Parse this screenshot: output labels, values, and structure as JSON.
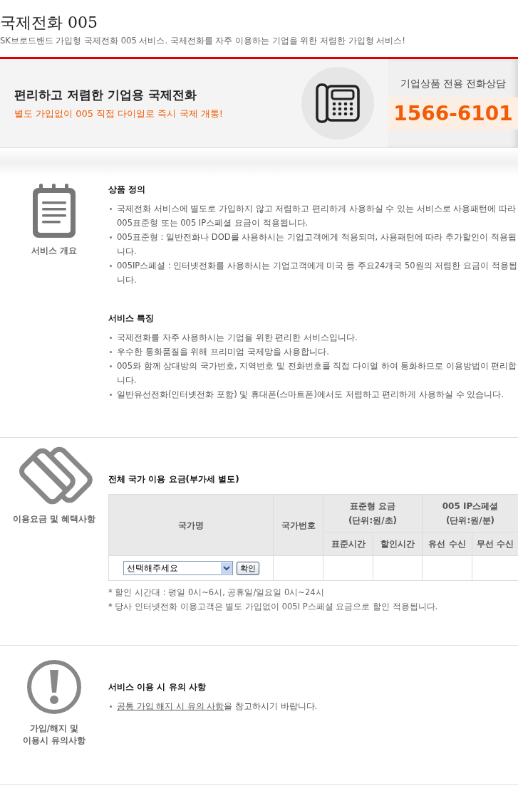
{
  "header": {
    "title": "국제전화 005",
    "subtitle": "SK브로드밴드 가입형 국제전화 005 서비스. 국제전화를 자주 이용하는 기업을 위한 저렴한 가입형 서비스!"
  },
  "banner": {
    "headline": "편리하고 저렴한 기업용 국제전화",
    "subline": "별도 가입없이 005 직접 다이얼로 즉시 국제 개통!",
    "contact_label": "기업상품 전용 전화상담",
    "phone": "1566-6101"
  },
  "sections": [
    {
      "kind": "overview",
      "icon_label": "서비스 개요",
      "blocks": [
        {
          "heading": "상품 정의",
          "items": [
            "국제전화 서비스에 별도로 가입하지 않고 저렴하고 편리하게 사용하실 수 있는 서비스로 사용패턴에 따라 005표준형 또는 005 IP스페셜 요금이 적용됩니다.",
            "005표준형 : 일반전화나 DOD를 사용하시는 기업고객에게 적용되며, 사용패턴에 따라 추가할인이 적용됩니다.",
            "005IP스페셜 : 인터넷전화를 사용하시는 기업고객에게 미국 등 주요24개국 50원의 저렴한 요금이 적용됩니다."
          ]
        },
        {
          "heading": "서비스 특징",
          "items": [
            "국제전화를 자주 사용하시는 기업을 위한 편리한 서비스입니다.",
            "우수한 통화품질을 위해 프리미엄 국제망을 사용합니다.",
            "005와 함께 상대방의 국가번호, 지역번호 및 전화번호를 직접 다이얼 하여 통화하므로 이용방법이 편리합니다.",
            "일반유선전화(인터넷전화 포함) 및 휴대폰(스마트폰)에서도 저렴하고 편리하게 사용하실 수 있습니다."
          ]
        }
      ]
    },
    {
      "kind": "fees",
      "icon_label": "이용요금 및 혜택사항",
      "heading": "전체 국가 이용 요금(부가세 별도)",
      "table": {
        "country_header": "국가명",
        "code_header": "국가번호",
        "groups": [
          {
            "label": "표준형 요금",
            "unit": "(단위:원/초)",
            "subcolumns": [
              "표준시간",
              "할인시간"
            ]
          },
          {
            "label": "005 IP스페셜",
            "unit": "(단위:원/분)",
            "subcolumns": [
              "유선 수신",
              "무선 수신"
            ]
          }
        ],
        "select_value": "선택해주세요",
        "confirm_button": "확인"
      },
      "notes": [
        "* 할인 시간대 : 평일 0시~6시, 공휴일/일요일 0시~24시",
        "* 당사 인터넷전화 이용고객은 별도 가입없이 005I P스페셜 요금으로 할인 적용됩니다."
      ]
    },
    {
      "kind": "notice",
      "icon_label": "가입/해지 및\n이용시 유의사항",
      "heading": "서비스 이용 시 유의 사항",
      "link": "공통 가입 해지 시 유의 사항",
      "after_link": "을 참고하시기 바랍니다."
    }
  ]
}
